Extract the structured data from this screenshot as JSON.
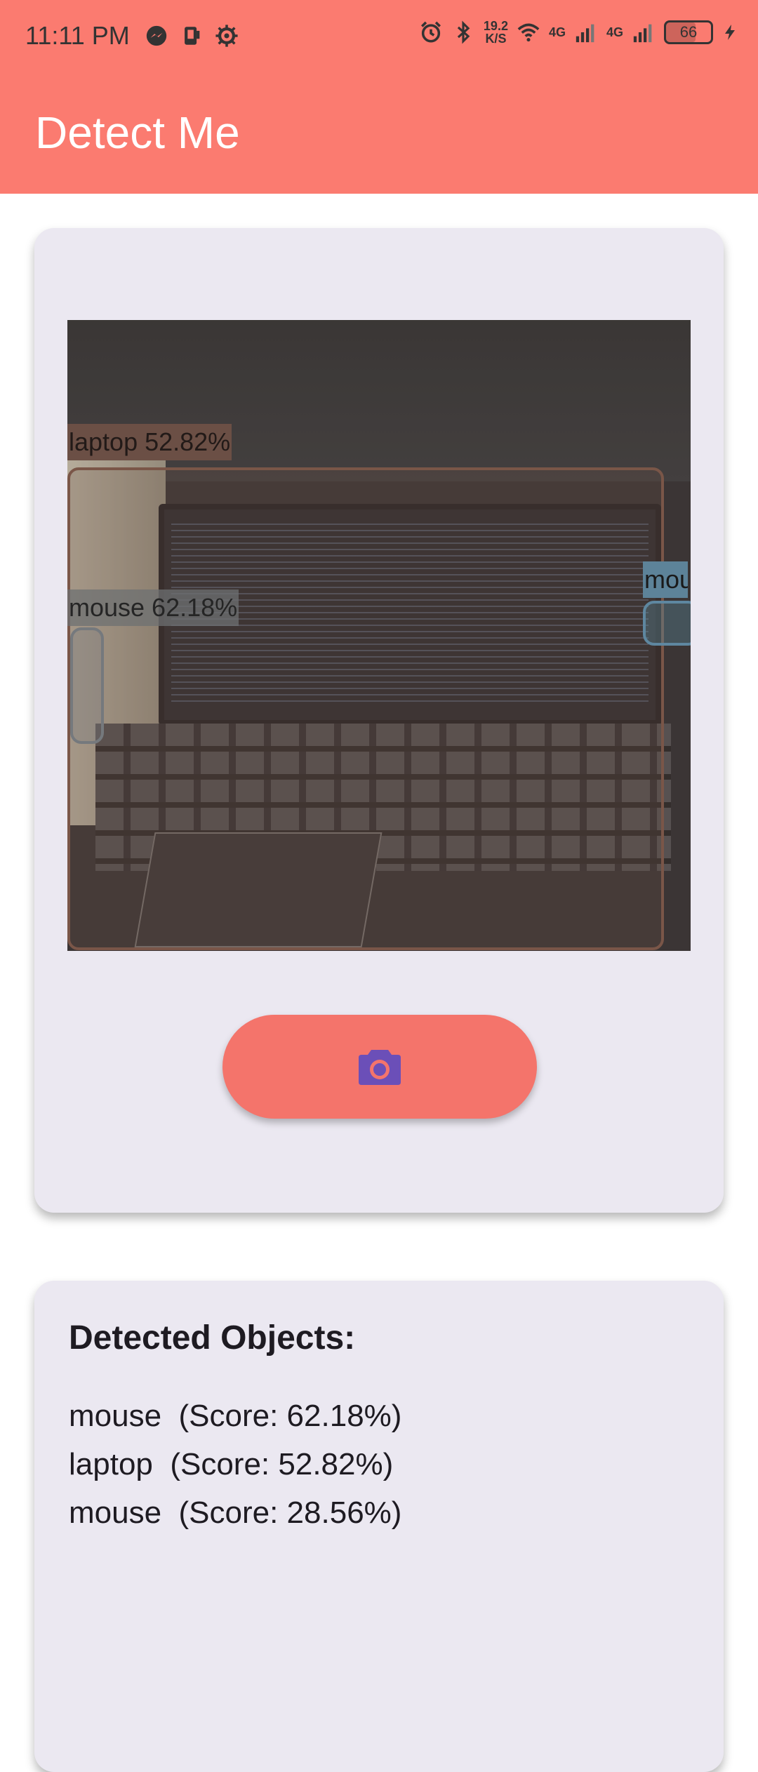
{
  "status_bar": {
    "time": "11:11 PM",
    "net_speed_value": "19.2",
    "net_speed_unit": "K/S",
    "sim1_label": "4G",
    "sim2_label": "4G",
    "battery_level": "66",
    "battery_fraction": 0.66,
    "icons": [
      "messenger-icon",
      "notification-icon",
      "settings-icon",
      "alarm-icon",
      "bluetooth-icon",
      "wifi-icon",
      "signal-icon",
      "signal-icon",
      "battery-icon",
      "charging-icon"
    ]
  },
  "app_bar": {
    "title": "Detect Me",
    "color": "#fb7b70"
  },
  "detection_image": {
    "labels": [
      {
        "text": "laptop 52.82%",
        "color": "#6b4f45"
      },
      {
        "text": "mouse 62.18%",
        "color": "#6e7072"
      },
      {
        "text": "mouse",
        "color": "#5d8399"
      }
    ]
  },
  "camera_button": {
    "icon": "camera-icon",
    "color": "#f4746b",
    "icon_color": "#6b4fb8"
  },
  "results": {
    "title": "Detected Objects:",
    "items": [
      "mouse  (Score: 62.18%)",
      "laptop  (Score: 52.82%)",
      "mouse  (Score: 28.56%)"
    ]
  }
}
